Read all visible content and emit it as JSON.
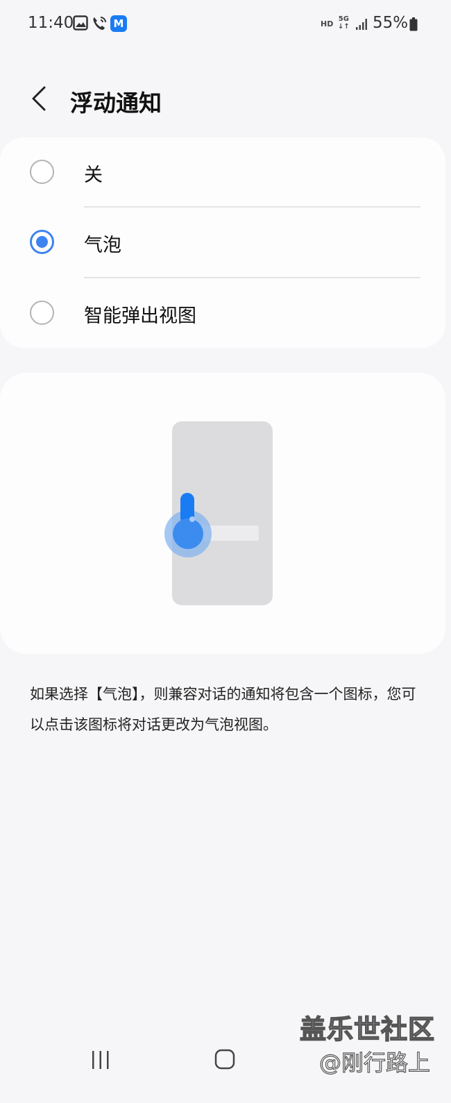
{
  "status_bar": {
    "time": "11:40",
    "network_hd": "HD",
    "network_5g": "5G",
    "battery": "55%",
    "icons": [
      "gallery-icon",
      "wifi-call-icon",
      "m-app-icon",
      "signal-icon",
      "battery-icon"
    ]
  },
  "header": {
    "title": "浮动通知"
  },
  "options": [
    {
      "label": "关",
      "selected": false
    },
    {
      "label": "气泡",
      "selected": true
    },
    {
      "label": "智能弹出视图",
      "selected": false
    }
  ],
  "description": "如果选择【气泡】，则兼容对话的通知将包含一个图标，您可以点击该图标将对话更改为气泡视图。",
  "watermark": {
    "line1": "盖乐世社区",
    "line2": "@刚行路上"
  },
  "colors": {
    "accent": "#3c84f0",
    "bubble": "#1a7cf3",
    "background": "#f6f6f8",
    "card": "#fdfdfe"
  }
}
